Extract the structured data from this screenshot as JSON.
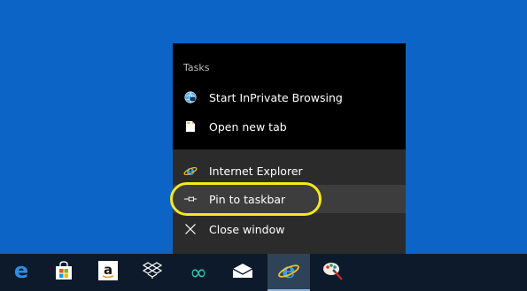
{
  "jumplist": {
    "section_title": "Tasks",
    "tasks": [
      {
        "label": "Start InPrivate Browsing",
        "icon": "inprivate-globe-icon"
      },
      {
        "label": "Open new tab",
        "icon": "new-tab-page-icon"
      }
    ],
    "bottom": [
      {
        "label": "Internet Explorer",
        "icon": "internet-explorer-icon"
      },
      {
        "label": "Pin to taskbar",
        "icon": "pin-icon"
      },
      {
        "label": "Close window",
        "icon": "close-icon"
      }
    ]
  },
  "taskbar": {
    "items": [
      {
        "name": "edge-icon"
      },
      {
        "name": "store-icon"
      },
      {
        "name": "amazon-icon",
        "glyph": "a"
      },
      {
        "name": "dropbox-icon"
      },
      {
        "name": "infinity-icon",
        "glyph": "∞"
      },
      {
        "name": "mail-icon"
      },
      {
        "name": "internet-explorer-icon",
        "active": true
      },
      {
        "name": "paint-icon"
      }
    ]
  },
  "colors": {
    "desktop": "#0b64c6",
    "jumplist": "#000000",
    "highlight": "#f5ea1a",
    "taskbar": "#0c1a2b"
  }
}
